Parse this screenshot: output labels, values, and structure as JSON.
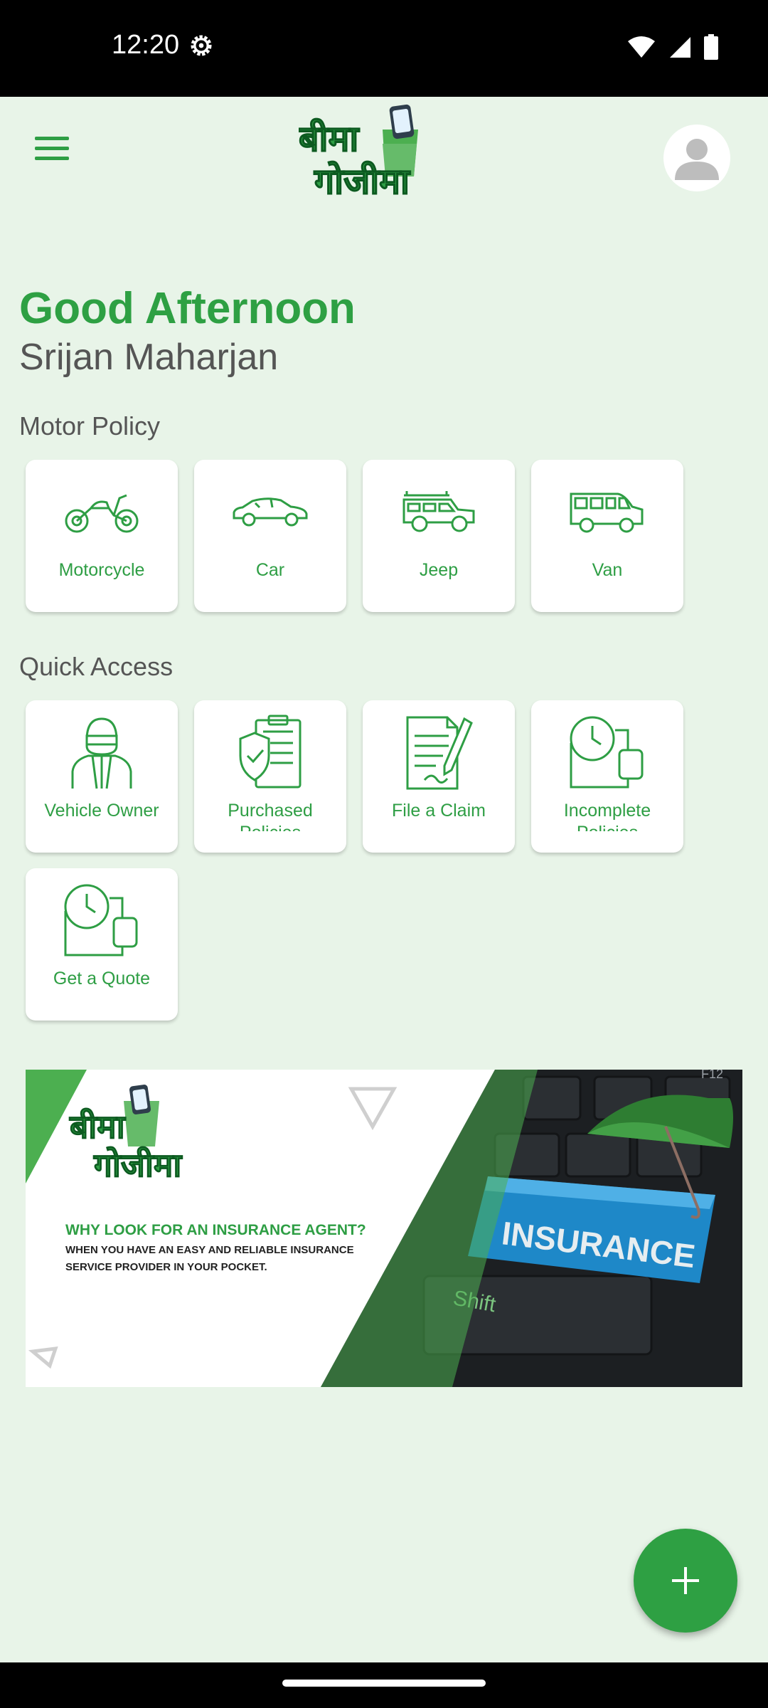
{
  "status": {
    "time": "12:20"
  },
  "header": {
    "logo_line1": "बीमा",
    "logo_line2": "गोजीमा"
  },
  "greeting": {
    "title": "Good Afternoon",
    "name": "Srijan Maharjan"
  },
  "motor_policy": {
    "title": "Motor Policy",
    "items": [
      {
        "label": "Motorcycle",
        "icon": "motorcycle-icon"
      },
      {
        "label": "Car",
        "icon": "car-icon"
      },
      {
        "label": "Jeep",
        "icon": "jeep-icon"
      },
      {
        "label": "Van",
        "icon": "van-icon"
      }
    ]
  },
  "quick_access": {
    "title": "Quick Access",
    "items": [
      {
        "label": "Vehicle Owner",
        "icon": "vehicle-owner-icon"
      },
      {
        "label": "Purchased Policies",
        "icon": "purchased-policies-icon"
      },
      {
        "label": "File a Claim",
        "icon": "file-claim-icon"
      },
      {
        "label": "Incomplete Policies",
        "icon": "incomplete-policies-icon"
      },
      {
        "label": "Get a Quote",
        "icon": "get-quote-icon"
      }
    ]
  },
  "banner": {
    "logo_line1": "बीमा",
    "logo_line2": "गोजीमा",
    "headline": "WHY LOOK FOR AN INSURANCE AGENT?",
    "subtext_line1": "WHEN YOU HAVE AN EASY AND RELIABLE INSURANCE",
    "subtext_line2": "SERVICE PROVIDER IN YOUR POCKET.",
    "key_label": "INSURANCE",
    "shift_label": "Shift",
    "f12_label": "F12"
  },
  "colors": {
    "accent": "#2ea043",
    "background": "#e8f4e8"
  }
}
